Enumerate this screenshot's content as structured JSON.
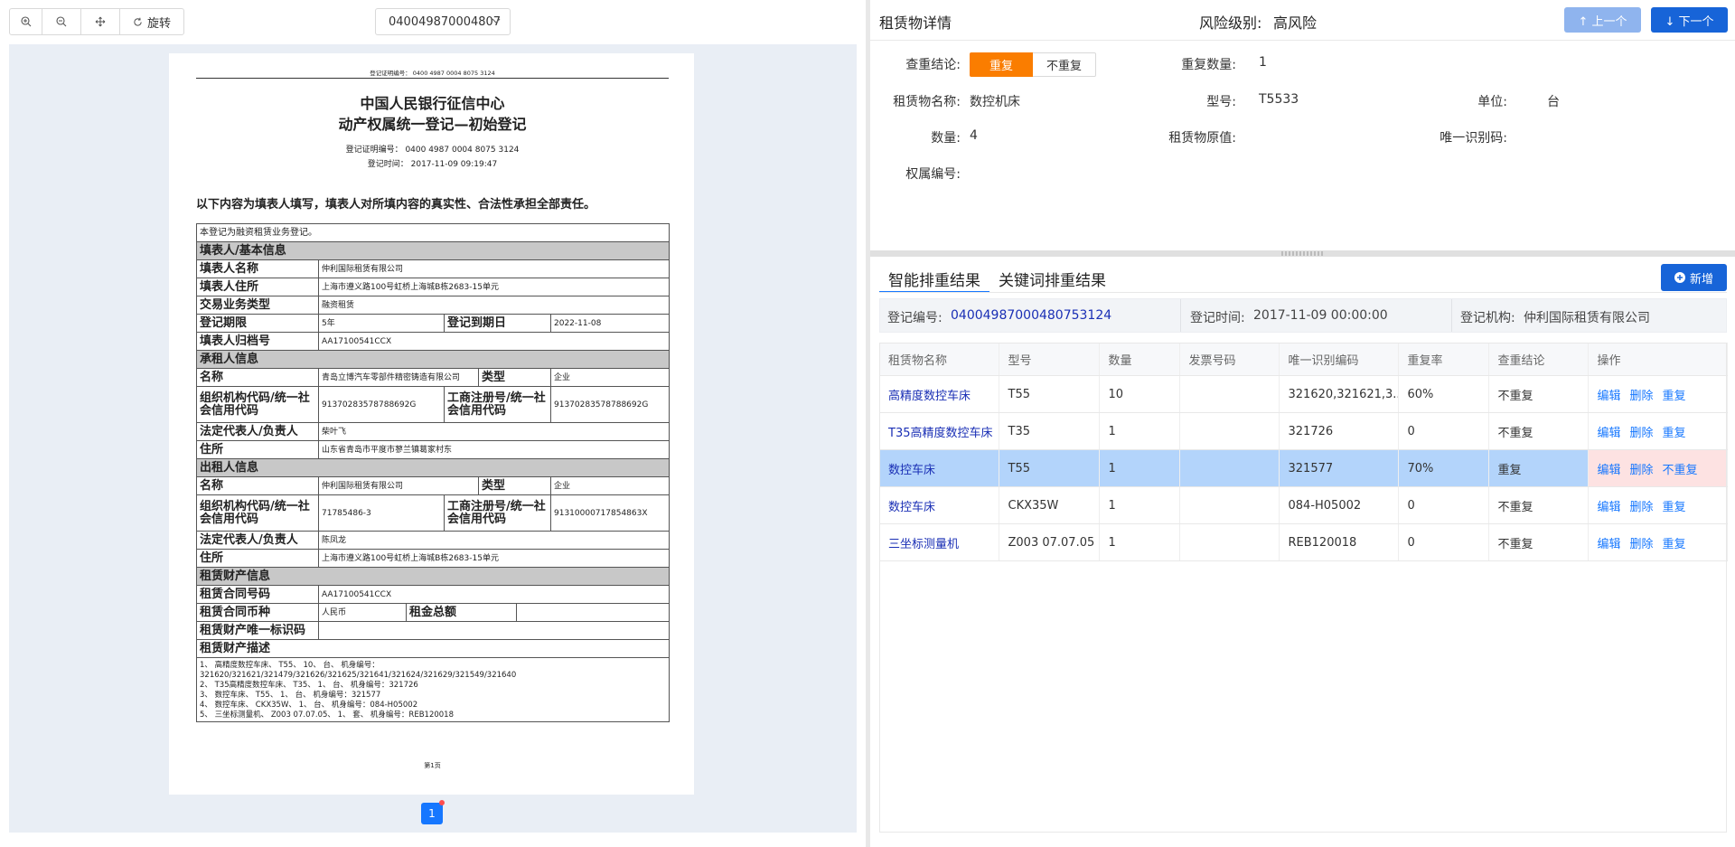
{
  "toolbar": {
    "zoom_in_icon": "zoom-in-icon",
    "zoom_out_icon": "zoom-out-icon",
    "move_icon": "move-icon",
    "rotate_label": "旋转"
  },
  "doc_select": {
    "value": "040049870004807"
  },
  "pager": {
    "current": "1"
  },
  "paper": {
    "cert_line": "登记证明编号： 0400 4987 0004 8075 3124",
    "title1": "中国人民银行征信中心",
    "title2": "动产权属统一登记—初始登记",
    "cert_no": "登记证明编号： 0400 4987 0004 8075 3124",
    "reg_time": "登记时间： 2017-11-09 09:19:47",
    "declaration": "以下内容为填表人填写，填表人对所填内容的真实性、合法性承担全部责任。",
    "note": "本登记为融资租赁业务登记。",
    "sec_filler": "填表人/基本信息",
    "filler_name_l": "填表人名称",
    "filler_name_v": "仲利国际租赁有限公司",
    "filler_addr_l": "填表人住所",
    "filler_addr_v": "上海市遵义路100号虹桥上海城B栋2683-15单元",
    "biz_type_l": "交易业务类型",
    "biz_type_v": "融资租赁",
    "period_l": "登记期限",
    "period_v": "5年",
    "expire_l": "登记到期日",
    "expire_v": "2022-11-08",
    "archive_l": "填表人归档号",
    "archive_v": "AA17100541CCX",
    "sec_lessee": "承租人信息",
    "name_l": "名称",
    "lessee_name_v": "青岛立博汽车零部件精密铸造有限公司",
    "type_l": "类型",
    "type_v": "企业",
    "org_code_l": "组织机构代码/统一社会信用代码",
    "lessee_org_v": "91370283578788692G",
    "biz_reg_l": "工商注册号/统一社会信用代码",
    "lessee_biz_v": "91370283578788692G",
    "legal_rep_l": "法定代表人/负责人",
    "lessee_rep_v": "柴叶飞",
    "addr_l": "住所",
    "lessee_addr_v": "山东省青岛市平度市蓼兰镇葛家村东",
    "sec_lessor": "出租人信息",
    "lessor_name_v": "仲利国际租赁有限公司",
    "lessor_org_v": "71785486-3",
    "lessor_biz_v": "91310000717854863X",
    "lessor_rep_v": "陈凤龙",
    "lessor_addr_v": "上海市遵义路100号虹桥上海城B栋2683-15单元",
    "sec_property": "租赁财产信息",
    "contract_l": "租赁合同号码",
    "contract_v": "AA17100541CCX",
    "currency_l": "租赁合同币种",
    "currency_v": "人民币",
    "rent_l": "租金总额",
    "rent_v": "",
    "uid_l": "租赁财产唯一标识码",
    "uid_v": "",
    "desc_l": "租赁财产描述",
    "desc_lines": [
      "1、 高精度数控车床、 T55、 10、 台、 机身编号：321620/321621/321479/321626/321625/321641/321624/321629/321549/321640",
      "2、 T35高精度数控车床、 T35、 1、 台、 机身编号：321726",
      "3、 数控车床、 T55、 1、 台、 机身编号：321577",
      "4、 数控车床、 CKX35W、 1、 台、 机身编号：084-H05002",
      "5、 三坐标测量机、 Z003 07.07.05、 1、 套、 机身编号：REB120018"
    ],
    "page_label": "第1页"
  },
  "detail": {
    "title": "租赁物详情",
    "risk_label": "风险级别:",
    "risk_value": "高风险",
    "prev_label": "↑ 上一个",
    "next_label": "↓ 下一个",
    "dup_check_label": "查重结论:",
    "dup_on": "重复",
    "dup_off": "不重复",
    "dup_count_label": "重复数量:",
    "dup_count_value": "1",
    "item_name_label": "租赁物名称:",
    "item_name_value": "数控机床",
    "model_label": "型号:",
    "model_value": "T5533",
    "unit_label": "单位:",
    "unit_value": "台",
    "qty_label": "数量:",
    "qty_value": "4",
    "orig_value_label": "租赁物原值:",
    "orig_value_value": "",
    "uid_label": "唯一识别码:",
    "uid_value": "",
    "ownership_label": "权属编号:",
    "ownership_value": ""
  },
  "results": {
    "tabs": [
      "智能排重结果",
      "关键词排重结果"
    ],
    "add_label": "新增",
    "reg_no_label": "登记编号:",
    "reg_no_value": "04004987000480753124",
    "reg_time_label": "登记时间:",
    "reg_time_value": "2017-11-09 00:00:00",
    "reg_org_label": "登记机构:",
    "reg_org_value": "仲利国际租赁有限公司",
    "columns": [
      "租赁物名称",
      "型号",
      "数量",
      "发票号码",
      "唯一识别编码",
      "重复率",
      "查重结论",
      "操作"
    ],
    "rows": [
      {
        "name": "高精度数控车床",
        "model": "T55",
        "qty": "10",
        "invoice": "",
        "uid": "321620,321621,3...",
        "rate": "60%",
        "result": "不重复",
        "op3": "重复"
      },
      {
        "name": "T35高精度数控车床",
        "model": "T35",
        "qty": "1",
        "invoice": "",
        "uid": "321726",
        "rate": "0",
        "result": "不重复",
        "op3": "重复"
      },
      {
        "name": "数控车床",
        "model": "T55",
        "qty": "1",
        "invoice": "",
        "uid": "321577",
        "rate": "70%",
        "result": "重复",
        "op3": "不重复"
      },
      {
        "name": "数控车床",
        "model": "CKX35W",
        "qty": "1",
        "invoice": "",
        "uid": "084-H05002",
        "rate": "0",
        "result": "不重复",
        "op3": "重复"
      },
      {
        "name": "三坐标测量机",
        "model": "Z003 07.07.05",
        "qty": "1",
        "invoice": "",
        "uid": "REB120018",
        "rate": "0",
        "result": "不重复",
        "op3": "重复"
      }
    ],
    "edit_label": "编辑",
    "delete_label": "删除"
  },
  "colors": {
    "accent": "#1677ff",
    "primary_btn": "#1764d8",
    "dup_orange": "#fa7d00",
    "selected_row": "#b3d4fb",
    "selected_ops": "#fde2e2"
  }
}
